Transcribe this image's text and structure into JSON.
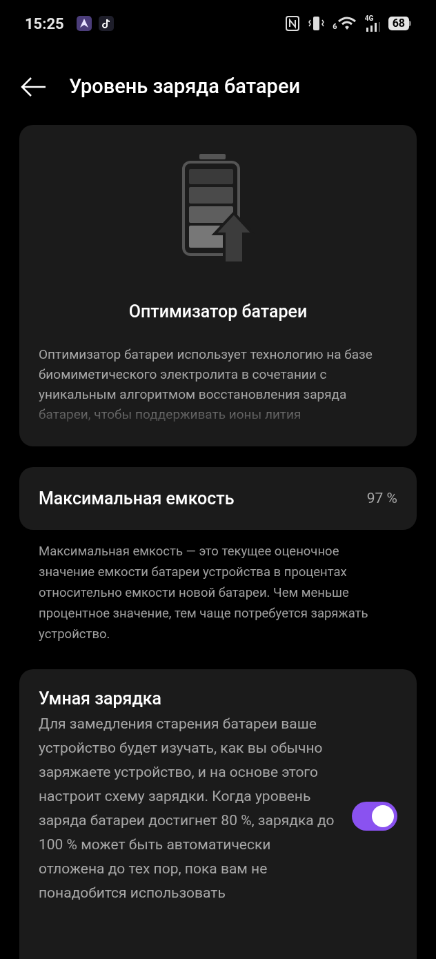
{
  "status_bar": {
    "time": "15:25",
    "wifi_label": "6",
    "network": "4G",
    "battery": "68"
  },
  "header": {
    "title": "Уровень заряда батареи"
  },
  "optimizer": {
    "title": "Оптимизатор батареи",
    "description": "Оптимизатор батареи использует технологию на базе биомиметического электролита в сочетании с уникальным алгоритмом восстановления заряда батареи, чтобы поддерживать ионы лития"
  },
  "max_capacity": {
    "label": "Максимальная емкость",
    "value": "97 %",
    "note": "Максимальная емкость — это текущее оценочное значение емкости батареи устройства в процентах относительно емкости новой батареи. Чем меньше процентное значение, тем чаще потребуется заряжать устройство."
  },
  "smart_charging": {
    "title": "Умная зарядка",
    "description": "Для замедления старения батареи ваше устройство будет изучать, как вы обычно заряжаете устройство, и на основе этого настроит схему зарядки. Когда уровень заряда батареи достигнет 80 %, зарядка до 100 % может быть автоматически отложена до тех пор, пока вам не понадобится использовать",
    "on": true
  }
}
